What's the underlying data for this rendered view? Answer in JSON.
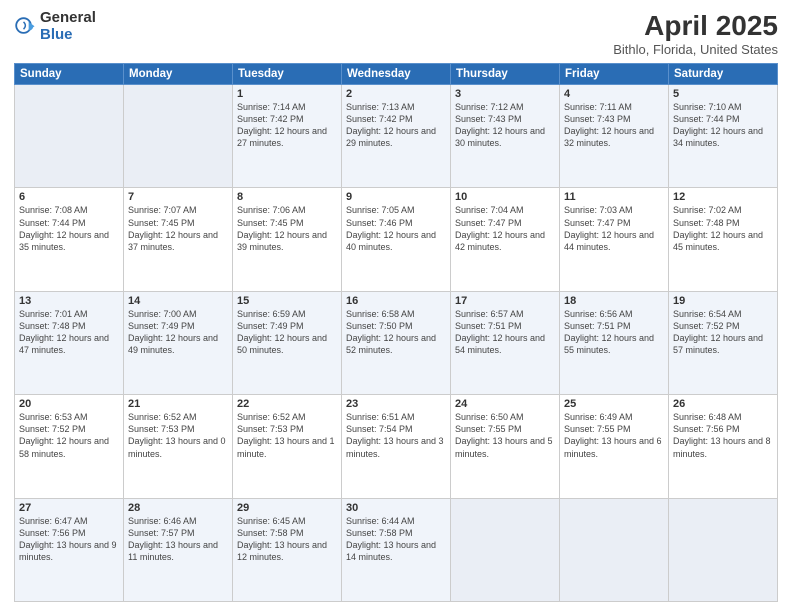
{
  "logo": {
    "general": "General",
    "blue": "Blue"
  },
  "title": "April 2025",
  "location": "Bithlo, Florida, United States",
  "days_of_week": [
    "Sunday",
    "Monday",
    "Tuesday",
    "Wednesday",
    "Thursday",
    "Friday",
    "Saturday"
  ],
  "weeks": [
    [
      {
        "day": "",
        "info": ""
      },
      {
        "day": "",
        "info": ""
      },
      {
        "day": "1",
        "info": "Sunrise: 7:14 AM\nSunset: 7:42 PM\nDaylight: 12 hours and 27 minutes."
      },
      {
        "day": "2",
        "info": "Sunrise: 7:13 AM\nSunset: 7:42 PM\nDaylight: 12 hours and 29 minutes."
      },
      {
        "day": "3",
        "info": "Sunrise: 7:12 AM\nSunset: 7:43 PM\nDaylight: 12 hours and 30 minutes."
      },
      {
        "day": "4",
        "info": "Sunrise: 7:11 AM\nSunset: 7:43 PM\nDaylight: 12 hours and 32 minutes."
      },
      {
        "day": "5",
        "info": "Sunrise: 7:10 AM\nSunset: 7:44 PM\nDaylight: 12 hours and 34 minutes."
      }
    ],
    [
      {
        "day": "6",
        "info": "Sunrise: 7:08 AM\nSunset: 7:44 PM\nDaylight: 12 hours and 35 minutes."
      },
      {
        "day": "7",
        "info": "Sunrise: 7:07 AM\nSunset: 7:45 PM\nDaylight: 12 hours and 37 minutes."
      },
      {
        "day": "8",
        "info": "Sunrise: 7:06 AM\nSunset: 7:45 PM\nDaylight: 12 hours and 39 minutes."
      },
      {
        "day": "9",
        "info": "Sunrise: 7:05 AM\nSunset: 7:46 PM\nDaylight: 12 hours and 40 minutes."
      },
      {
        "day": "10",
        "info": "Sunrise: 7:04 AM\nSunset: 7:47 PM\nDaylight: 12 hours and 42 minutes."
      },
      {
        "day": "11",
        "info": "Sunrise: 7:03 AM\nSunset: 7:47 PM\nDaylight: 12 hours and 44 minutes."
      },
      {
        "day": "12",
        "info": "Sunrise: 7:02 AM\nSunset: 7:48 PM\nDaylight: 12 hours and 45 minutes."
      }
    ],
    [
      {
        "day": "13",
        "info": "Sunrise: 7:01 AM\nSunset: 7:48 PM\nDaylight: 12 hours and 47 minutes."
      },
      {
        "day": "14",
        "info": "Sunrise: 7:00 AM\nSunset: 7:49 PM\nDaylight: 12 hours and 49 minutes."
      },
      {
        "day": "15",
        "info": "Sunrise: 6:59 AM\nSunset: 7:49 PM\nDaylight: 12 hours and 50 minutes."
      },
      {
        "day": "16",
        "info": "Sunrise: 6:58 AM\nSunset: 7:50 PM\nDaylight: 12 hours and 52 minutes."
      },
      {
        "day": "17",
        "info": "Sunrise: 6:57 AM\nSunset: 7:51 PM\nDaylight: 12 hours and 54 minutes."
      },
      {
        "day": "18",
        "info": "Sunrise: 6:56 AM\nSunset: 7:51 PM\nDaylight: 12 hours and 55 minutes."
      },
      {
        "day": "19",
        "info": "Sunrise: 6:54 AM\nSunset: 7:52 PM\nDaylight: 12 hours and 57 minutes."
      }
    ],
    [
      {
        "day": "20",
        "info": "Sunrise: 6:53 AM\nSunset: 7:52 PM\nDaylight: 12 hours and 58 minutes."
      },
      {
        "day": "21",
        "info": "Sunrise: 6:52 AM\nSunset: 7:53 PM\nDaylight: 13 hours and 0 minutes."
      },
      {
        "day": "22",
        "info": "Sunrise: 6:52 AM\nSunset: 7:53 PM\nDaylight: 13 hours and 1 minute."
      },
      {
        "day": "23",
        "info": "Sunrise: 6:51 AM\nSunset: 7:54 PM\nDaylight: 13 hours and 3 minutes."
      },
      {
        "day": "24",
        "info": "Sunrise: 6:50 AM\nSunset: 7:55 PM\nDaylight: 13 hours and 5 minutes."
      },
      {
        "day": "25",
        "info": "Sunrise: 6:49 AM\nSunset: 7:55 PM\nDaylight: 13 hours and 6 minutes."
      },
      {
        "day": "26",
        "info": "Sunrise: 6:48 AM\nSunset: 7:56 PM\nDaylight: 13 hours and 8 minutes."
      }
    ],
    [
      {
        "day": "27",
        "info": "Sunrise: 6:47 AM\nSunset: 7:56 PM\nDaylight: 13 hours and 9 minutes."
      },
      {
        "day": "28",
        "info": "Sunrise: 6:46 AM\nSunset: 7:57 PM\nDaylight: 13 hours and 11 minutes."
      },
      {
        "day": "29",
        "info": "Sunrise: 6:45 AM\nSunset: 7:58 PM\nDaylight: 13 hours and 12 minutes."
      },
      {
        "day": "30",
        "info": "Sunrise: 6:44 AM\nSunset: 7:58 PM\nDaylight: 13 hours and 14 minutes."
      },
      {
        "day": "",
        "info": ""
      },
      {
        "day": "",
        "info": ""
      },
      {
        "day": "",
        "info": ""
      }
    ]
  ]
}
